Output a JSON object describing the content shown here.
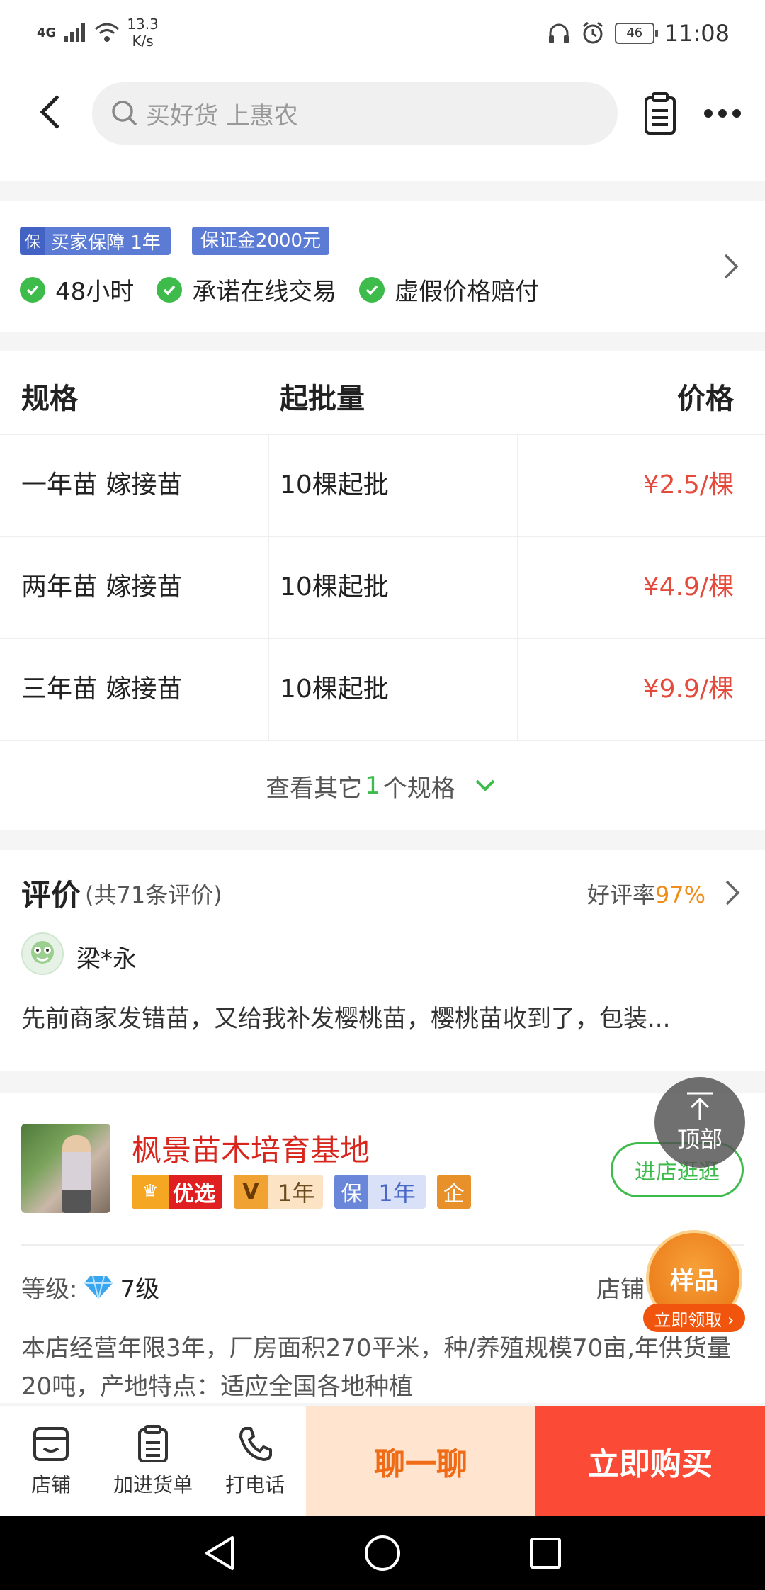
{
  "status_bar": {
    "network": "4G",
    "speed_value": "13.3",
    "speed_unit": "K/s",
    "battery": "46",
    "time": "11:08"
  },
  "nav": {
    "search_placeholder": "买好货 上惠农"
  },
  "guarantee": {
    "badge_icon_text": "保",
    "badge_label": "买家保障 1年",
    "deposit": "保证金2000元",
    "items": [
      "48小时",
      "承诺在线交易",
      "虚假价格赔付"
    ]
  },
  "spec_table": {
    "headers": [
      "规格",
      "起批量",
      "价格"
    ],
    "rows": [
      {
        "spec": "一年苗 嫁接苗",
        "moq": "10棵起批",
        "price": "¥2.5/棵"
      },
      {
        "spec": "两年苗 嫁接苗",
        "moq": "10棵起批",
        "price": "¥4.9/棵"
      },
      {
        "spec": "三年苗 嫁接苗",
        "moq": "10棵起批",
        "price": "¥9.9/棵"
      }
    ],
    "more_prefix": "查看其它",
    "more_count": "1",
    "more_suffix": "个规格"
  },
  "reviews": {
    "title": "评价",
    "count": "(共71条评价)",
    "rate_label": "好评率",
    "rate_value": "97%",
    "user": "梁*永",
    "text": "先前商家发错苗，又给我补发樱桃苗，樱桃苗收到了，包装..."
  },
  "shop": {
    "name": "枫景苗木培育基地",
    "tag_youxuan": "优选",
    "tag_v_letter": "V",
    "tag_v_years": "1年",
    "tag_bao_letter": "保",
    "tag_bao_years": "1年",
    "tag_qi": "企",
    "enter_label": "进店逛逛",
    "level_label": "等级:",
    "level_value": "7级",
    "right_label": "店铺",
    "description": "本店经营年限3年，厂房面积270平米，种/养殖规模70亩,年供货量20吨，产地特点：适应全国各地种植"
  },
  "floating": {
    "to_top": "顶部",
    "sample_title": "样品",
    "sample_action": "立即领取 ›"
  },
  "bottom_bar": {
    "shop": "店铺",
    "cart": "加进货单",
    "call": "打电话",
    "chat": "聊一聊",
    "buy": "立即购买"
  },
  "colors": {
    "price_red": "#e54b3c",
    "green": "#3dbb4b",
    "chat_bg": "#ffe4cf",
    "buy_bg": "#fb4a35"
  }
}
